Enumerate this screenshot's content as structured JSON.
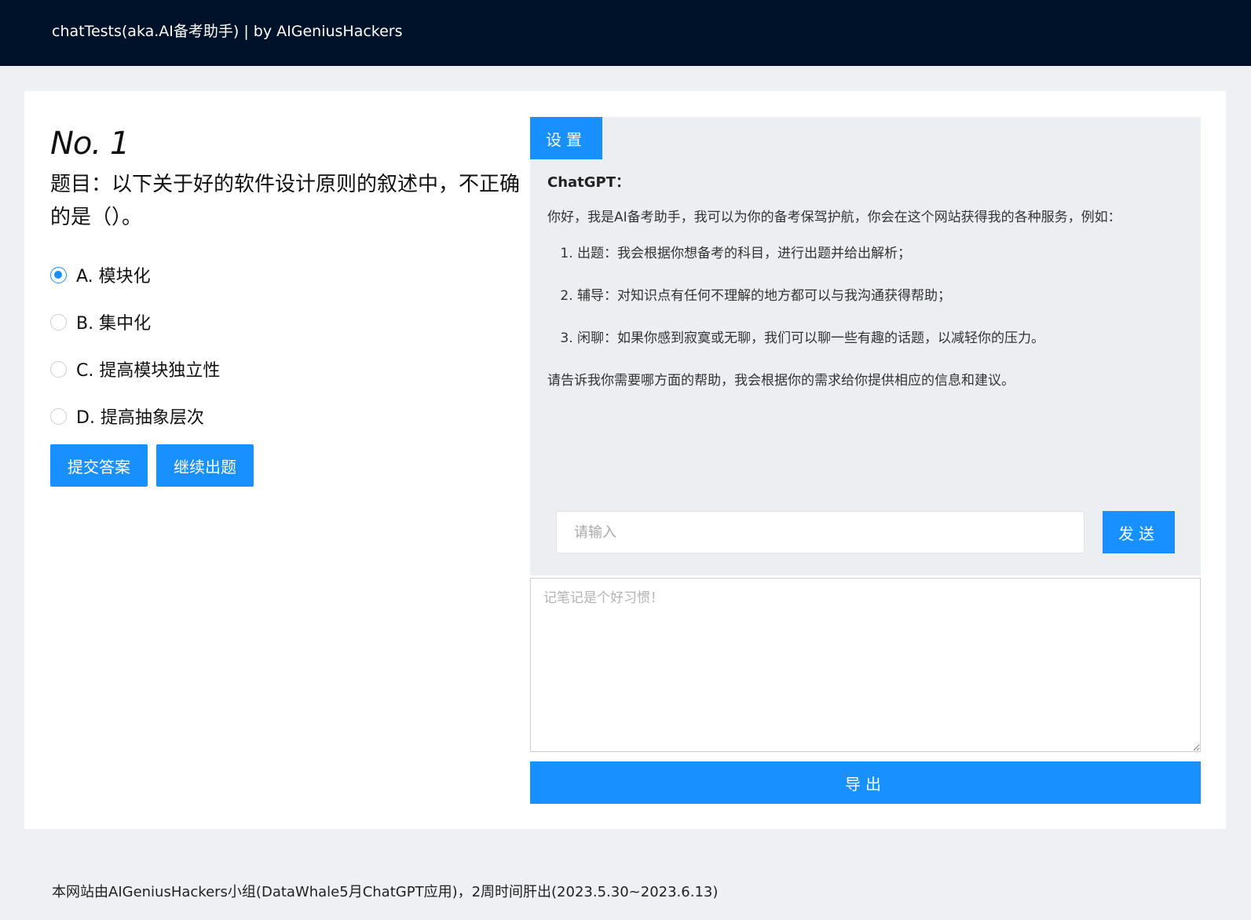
{
  "header": {
    "title": "chatTests(aka.AI备考助手) | by AIGeniusHackers"
  },
  "question": {
    "number": "No. 1",
    "text": "题目：以下关于好的软件设计原则的叙述中，不正确的是（）。",
    "options": [
      {
        "label": "A. 模块化",
        "checked": true
      },
      {
        "label": "B. 集中化",
        "checked": false
      },
      {
        "label": "C. 提高模块独立性",
        "checked": false
      },
      {
        "label": "D. 提高抽象层次",
        "checked": false
      }
    ],
    "submit_label": "提交答案",
    "next_label": "继续出题"
  },
  "chat": {
    "settings_label": "设置",
    "sender": "ChatGPT：",
    "intro": "你好，我是AI备考助手，我可以为你的备考保驾护航，你会在这个网站获得我的各种服务，例如：",
    "items": [
      "出题：我会根据你想备考的科目，进行出题并给出解析；",
      "辅导：对知识点有任何不理解的地方都可以与我沟通获得帮助；",
      "闲聊：如果你感到寂寞或无聊，我们可以聊一些有趣的话题，以减轻你的压力。"
    ],
    "outro": "请告诉我你需要哪方面的帮助，我会根据你的需求给你提供相应的信息和建议。",
    "input_placeholder": "请输入",
    "send_label": "发送"
  },
  "notes": {
    "placeholder": "记笔记是个好习惯！",
    "export_label": "导出"
  },
  "footer": {
    "text": "本网站由AIGeniusHackers小组(DataWhale5月ChatGPT应用)，2周时间肝出(2023.5.30~2023.6.13)"
  },
  "colors": {
    "header_bg": "#001229",
    "accent": "#1890ff",
    "page_bg": "#eef0f4",
    "chat_bg": "#eceef2"
  }
}
